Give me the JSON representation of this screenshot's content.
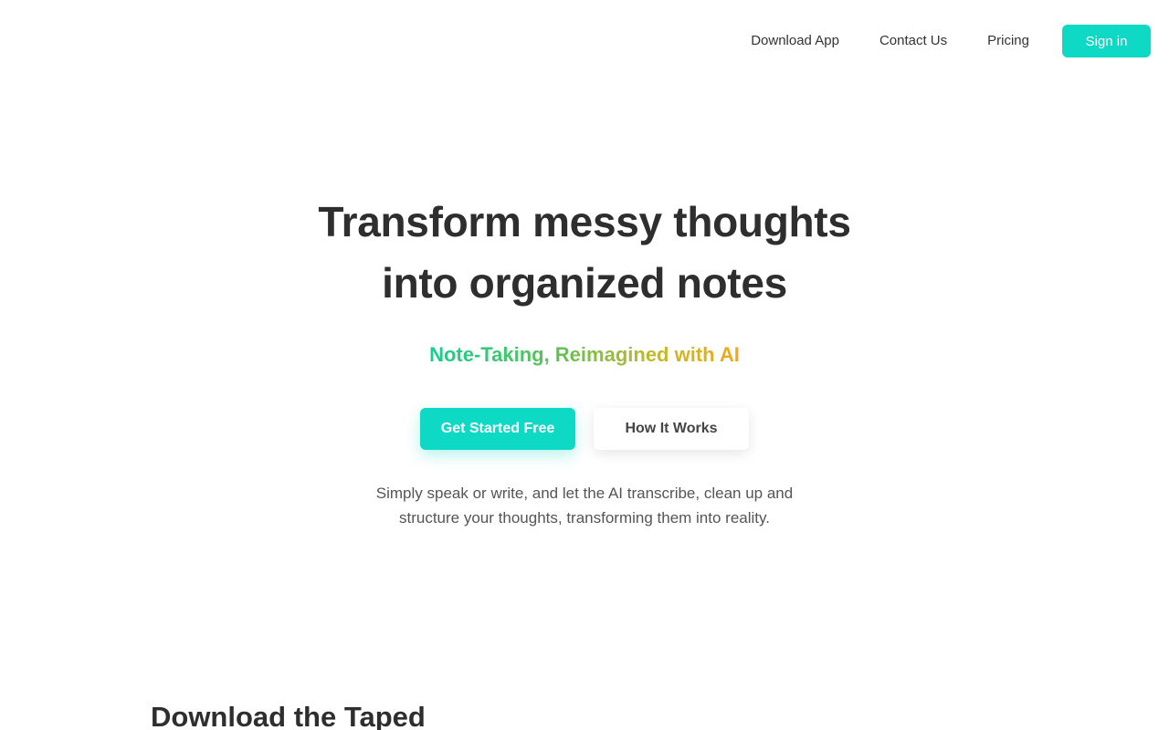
{
  "nav": {
    "links": [
      "Download App",
      "Contact Us",
      "Pricing"
    ],
    "signin_label": "Sign in"
  },
  "hero": {
    "title_line1": "Transform messy thoughts",
    "title_line2": "into organized notes",
    "tagline": "Note-Taking, Reimagined with AI",
    "primary_cta": "Get Started Free",
    "secondary_cta": "How It Works",
    "description": "Simply speak or write, and let the AI transcribe, clean up and structure your thoughts, transforming them into reality."
  },
  "download": {
    "heading": "Download the Taped"
  },
  "colors": {
    "accent": "#0dd9c5",
    "gradient_start": "#12cf8f",
    "gradient_end": "#f2a818",
    "text_dark": "#2e2e2e"
  }
}
